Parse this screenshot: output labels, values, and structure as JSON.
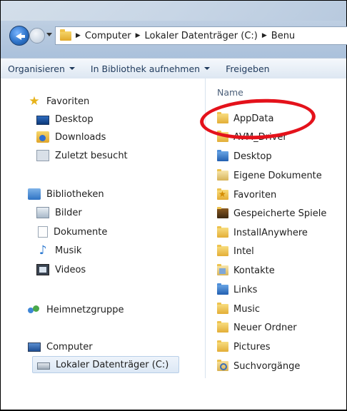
{
  "address_bar": {
    "crumbs": [
      "Computer",
      "Lokaler Datenträger (C:)",
      "Benu"
    ]
  },
  "command_bar": {
    "organize": "Organisieren",
    "include_library": "In Bibliothek aufnehmen",
    "share": "Freigeben"
  },
  "nav_pane": {
    "favorites_header": "Favoriten",
    "favorites": [
      "Desktop",
      "Downloads",
      "Zuletzt besucht"
    ],
    "libraries_header": "Bibliotheken",
    "libraries": [
      "Bilder",
      "Dokumente",
      "Musik",
      "Videos"
    ],
    "homegroup": "Heimnetzgruppe",
    "computer_header": "Computer",
    "drive": "Lokaler Datenträger (C:)"
  },
  "content": {
    "column_name": "Name",
    "items": [
      "AppData",
      "AVM_Driver",
      "Desktop",
      "Eigene Dokumente",
      "Favoriten",
      "Gespeicherte Spiele",
      "InstallAnywhere",
      "Intel",
      "Kontakte",
      "Links",
      "Music",
      "Neuer Ordner",
      "Pictures",
      "Suchvorgänge"
    ]
  },
  "colors": {
    "highlight": "#e4121b",
    "command_text": "#1e395b"
  }
}
